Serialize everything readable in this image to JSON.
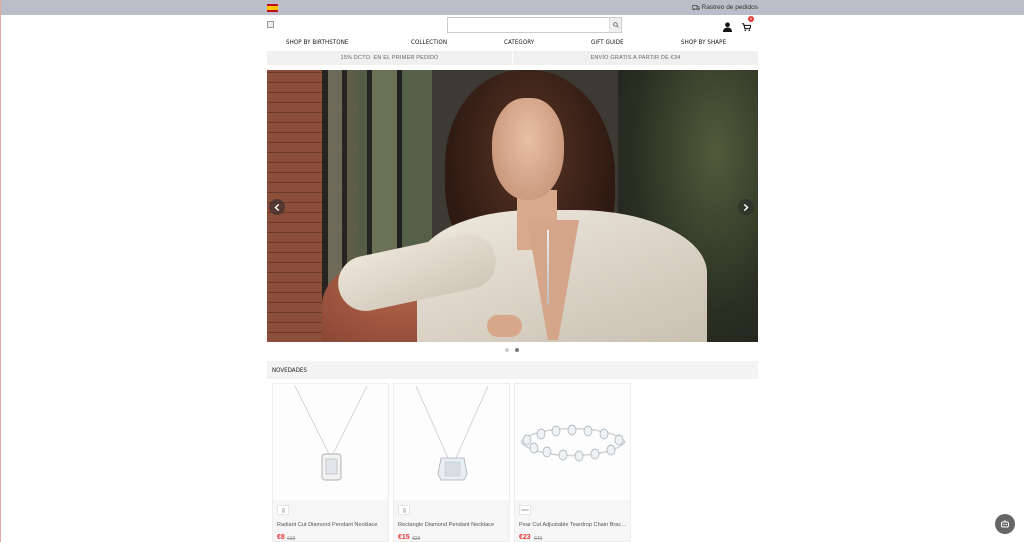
{
  "topbar": {
    "language": "Español",
    "track_label": "Rastreo de pedidos"
  },
  "header": {
    "search_placeholder": "",
    "cart_count": "0"
  },
  "nav": {
    "items": [
      {
        "label": "SHOP BY BIRTHSTONE"
      },
      {
        "label": "COLLECTION"
      },
      {
        "label": "CATEGORY"
      },
      {
        "label": "GIFT GUIDE"
      },
      {
        "label": "SHOP BY SHAPE"
      }
    ]
  },
  "promo": {
    "left": "15% DCTO. EN EL PRIMER PEDIDO",
    "right": "ENVÍO GRATIS A PARTIR DE €34"
  },
  "carousel": {
    "slides": 2,
    "active": 2
  },
  "section": {
    "title": "NOVEDADES"
  },
  "products": [
    {
      "title": "Radiant Cut Diamond Pendant Necklace",
      "price": "€8",
      "old_price": "€19",
      "kind": "pendant-square"
    },
    {
      "title": "Rectangle Diamond Pendant Necklace",
      "price": "€15",
      "old_price": "€29",
      "kind": "pendant-rect"
    },
    {
      "title": "Pear Cut Adjustable Teardrop Chain Bracelet",
      "price": "€23",
      "old_price": "€46",
      "kind": "bracelet"
    }
  ],
  "colors": {
    "accent_red": "#e53935",
    "topbar": "#b9bec8",
    "promo_bg": "#f0f0f0"
  }
}
